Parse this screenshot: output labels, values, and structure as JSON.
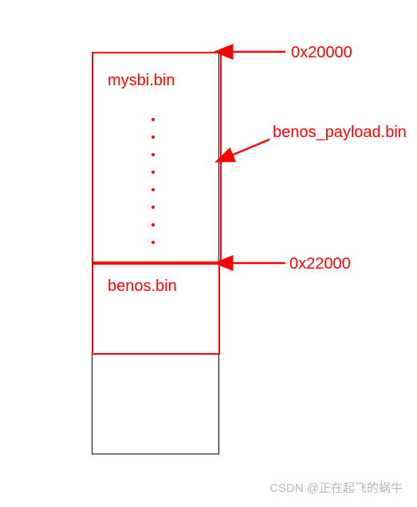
{
  "memory_layout": {
    "top_section": {
      "label": "mysbi.bin",
      "start_addr": "0x20000"
    },
    "mid_section": {
      "label": "benos.bin",
      "start_addr": "0x22000"
    },
    "overall_label": "benos_payload.bin"
  },
  "watermark": "CSDN @正在起飞的蜗牛",
  "colors": {
    "accent": "#ff0000"
  }
}
